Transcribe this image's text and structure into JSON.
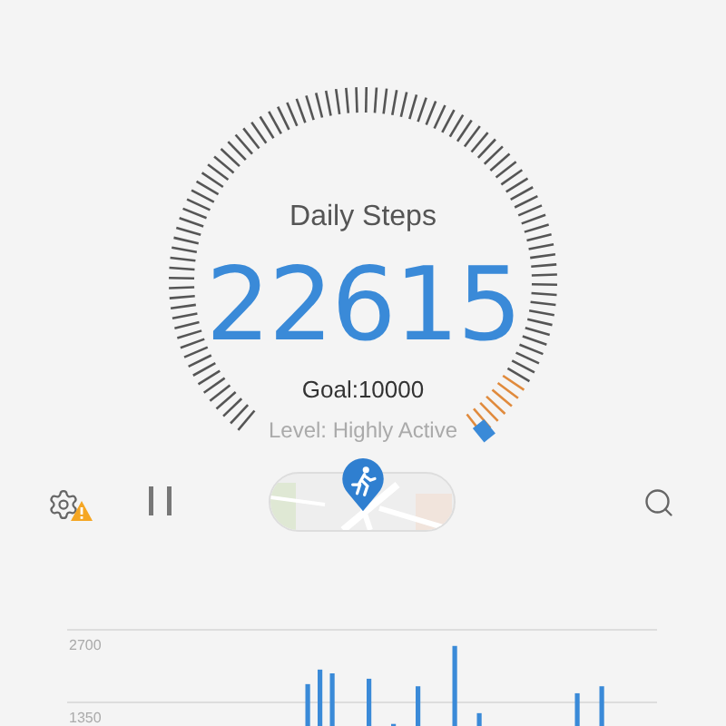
{
  "gauge": {
    "title": "Daily Steps",
    "steps": "22615",
    "goal": "Goal:10000",
    "level_text": "Level: Highly Active"
  },
  "toolbar": [
    {
      "kind": "settings_warning"
    },
    {
      "kind": "pause"
    },
    {
      "kind": "map"
    },
    {
      "kind": "search"
    }
  ],
  "chart": {
    "chart_data": {
      "type": "bar",
      "values": [
        0,
        0,
        0,
        0,
        0,
        0,
        0,
        0,
        0,
        0,
        0,
        0,
        0,
        0,
        0,
        0,
        0,
        0,
        0,
        1690,
        1960,
        1890,
        0,
        0,
        1790,
        0,
        950,
        0,
        1650,
        0,
        0,
        2400,
        0,
        1150,
        0,
        0,
        0,
        0,
        0,
        0,
        0,
        1520,
        0,
        1650,
        0,
        0,
        0,
        0
      ],
      "ylim": [
        0,
        2700
      ],
      "yticks": [
        1350,
        2700
      ]
    }
  }
}
